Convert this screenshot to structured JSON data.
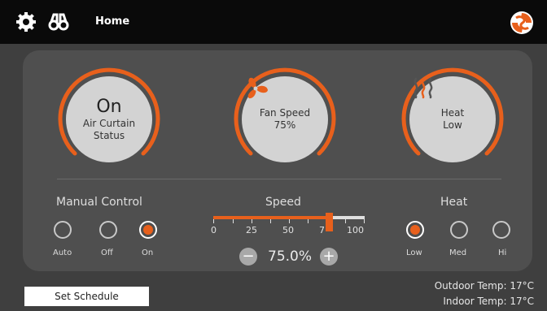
{
  "header": {
    "title": "Home",
    "icons": [
      "gear-icon",
      "binoculars-icon",
      "brand-logo"
    ]
  },
  "gauges": {
    "air_curtain": {
      "value": "On",
      "label_line1": "Air Curtain",
      "label_line2": "Status"
    },
    "fan": {
      "label": "Fan Speed",
      "value": "75%",
      "icon": "fan-icon"
    },
    "heat": {
      "label": "Heat",
      "value": "Low",
      "icon": "heat-waves-icon"
    }
  },
  "manual_control": {
    "title": "Manual Control",
    "options": [
      "Auto",
      "Off",
      "On"
    ],
    "selected": "On"
  },
  "speed": {
    "title": "Speed",
    "ticks": [
      "0",
      "25",
      "50",
      "7",
      "100"
    ],
    "value_text": "75.0%",
    "value_fraction": 0.75,
    "minus": "−",
    "plus": "+"
  },
  "heat": {
    "title": "Heat",
    "options": [
      "Low",
      "Med",
      "Hi"
    ],
    "selected": "Low"
  },
  "footer": {
    "schedule_button": "Set Schedule",
    "outdoor_temp": "Outdoor Temp: 17°C",
    "indoor_temp": "Indoor Temp: 17°C"
  },
  "colors": {
    "accent": "#e8601c",
    "topbar": "#0a0a0a",
    "background": "#3f3f3f",
    "panel": "#4f4f4f"
  }
}
